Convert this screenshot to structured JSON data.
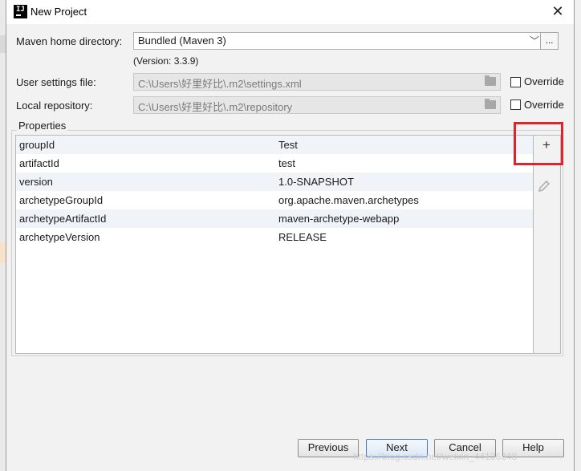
{
  "window": {
    "title": "New Project"
  },
  "maven_home": {
    "label": "Maven home directory:",
    "value": "Bundled (Maven 3)",
    "browse_label": "...",
    "version": "(Version: 3.3.9)"
  },
  "user_settings": {
    "label": "User settings file:",
    "value": "C:\\Users\\好里好比\\.m2\\settings.xml",
    "override_label": "Override"
  },
  "local_repo": {
    "label": "Local repository:",
    "value": "C:\\Users\\好里好比\\.m2\\repository",
    "override_label": "Override"
  },
  "properties": {
    "title": "Properties",
    "rows": [
      {
        "key": "groupId",
        "value": "Test"
      },
      {
        "key": "artifactId",
        "value": "test"
      },
      {
        "key": "version",
        "value": "1.0-SNAPSHOT"
      },
      {
        "key": "archetypeGroupId",
        "value": "org.apache.maven.archetypes"
      },
      {
        "key": "archetypeArtifactId",
        "value": "maven-archetype-webapp"
      },
      {
        "key": "archetypeVersion",
        "value": "RELEASE"
      }
    ],
    "add_label": "+"
  },
  "buttons": {
    "previous": "Previous",
    "next": "Next",
    "cancel": "Cancel",
    "help": "Help"
  },
  "watermark": "https://blog.csdn.net/weixin_44136348",
  "colors": {
    "highlight_box": "#d9262f",
    "primary_border": "#3a78c4"
  }
}
